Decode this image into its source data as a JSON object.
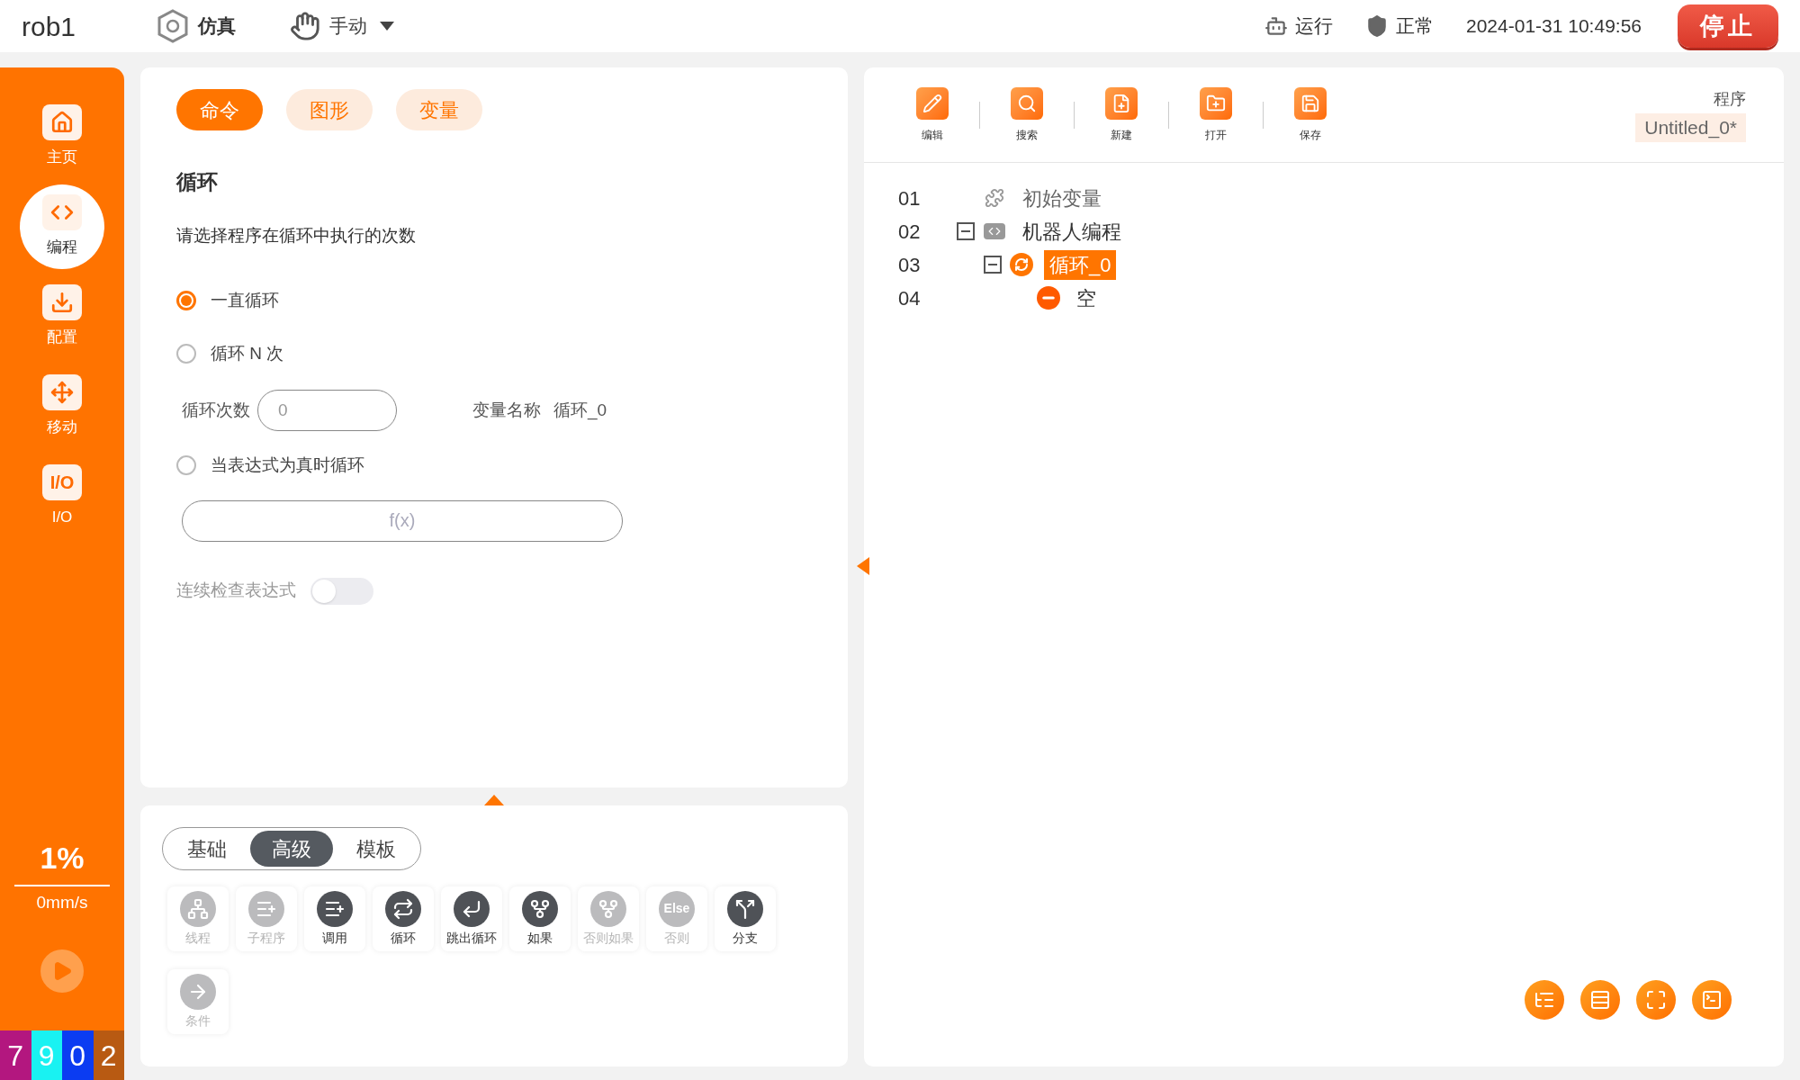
{
  "header": {
    "robot": "rob1",
    "mode": "仿真",
    "control": "手动",
    "statuses": [
      {
        "kind": "run",
        "label": "运行"
      },
      {
        "kind": "normal",
        "label": "正常"
      }
    ],
    "datetime": "2024-01-31 10:49:56",
    "stop_button": "停止"
  },
  "sidebar": {
    "items": [
      {
        "kind": "home",
        "label": "主页",
        "selected": false
      },
      {
        "kind": "code",
        "label": "编程",
        "selected": true
      },
      {
        "kind": "config",
        "label": "配置",
        "selected": false
      },
      {
        "kind": "move",
        "label": "移动",
        "selected": false
      },
      {
        "kind": "io",
        "label": "I/O",
        "glyph": "I/O",
        "selected": false
      }
    ],
    "speed": "1%",
    "velocity": "0mm/s",
    "counter": [
      {
        "digit": "7",
        "color": "#b3177f"
      },
      {
        "digit": "9",
        "color": "#19f2f2"
      },
      {
        "digit": "0",
        "color": "#0b3cf2"
      },
      {
        "digit": "2",
        "color": "#b85a12"
      }
    ]
  },
  "editor": {
    "tabs": [
      {
        "label": "命令",
        "selected": true
      },
      {
        "label": "图形",
        "selected": false
      },
      {
        "label": "变量",
        "selected": false
      }
    ],
    "title": "循环",
    "prompt": "请选择程序在循环中执行的次数",
    "options": [
      {
        "label": "一直循环",
        "selected": true
      },
      {
        "label": "循环 N 次",
        "selected": false
      },
      {
        "label": "当表达式为真时循环",
        "selected": false
      }
    ],
    "count_label": "循环次数",
    "count_value": "0",
    "variable_label": "变量名称",
    "variable_value": "循环_0",
    "expression": {
      "placeholder": "f(x)"
    },
    "continuous_check": {
      "label": "连续检查表达式",
      "on": false
    }
  },
  "palette": {
    "tabs": [
      {
        "label": "基础",
        "selected": false
      },
      {
        "label": "高级",
        "selected": true
      },
      {
        "label": "模板",
        "selected": false
      }
    ],
    "commands": [
      {
        "kind": "thread",
        "label": "线程",
        "disabled": true
      },
      {
        "kind": "subroutine",
        "label": "子程序",
        "disabled": true
      },
      {
        "kind": "call",
        "label": "调用",
        "disabled": false
      },
      {
        "kind": "loop",
        "label": "循环",
        "disabled": false
      },
      {
        "kind": "break",
        "label": "跳出循环",
        "disabled": false
      },
      {
        "kind": "if",
        "label": "如果",
        "disabled": false
      },
      {
        "kind": "elseif",
        "label": "否则如果",
        "disabled": true
      },
      {
        "kind": "else",
        "label": "否则",
        "glyph": "Else",
        "disabled": true
      },
      {
        "kind": "switch",
        "label": "分支",
        "disabled": false
      },
      {
        "kind": "condition",
        "label": "条件",
        "disabled": true
      }
    ]
  },
  "program": {
    "toolbar": [
      {
        "kind": "edit",
        "label": "编辑"
      },
      {
        "kind": "search",
        "label": "搜索"
      },
      {
        "kind": "new",
        "label": "新建"
      },
      {
        "kind": "open",
        "label": "打开"
      },
      {
        "kind": "save",
        "label": "保存"
      }
    ],
    "program_label": "程序",
    "program_name": "Untitled_0*",
    "tree": [
      {
        "line": "01",
        "kind": "variables",
        "label": "初始变量",
        "selected": false
      },
      {
        "line": "02",
        "kind": "program",
        "label": "机器人编程",
        "selected": false,
        "expanded": true,
        "children": [
          {
            "line": "03",
            "kind": "loop",
            "label": "循环_0",
            "selected": true,
            "expanded": true,
            "children": [
              {
                "line": "04",
                "kind": "empty",
                "label": "空",
                "selected": false
              }
            ]
          }
        ]
      }
    ]
  }
}
